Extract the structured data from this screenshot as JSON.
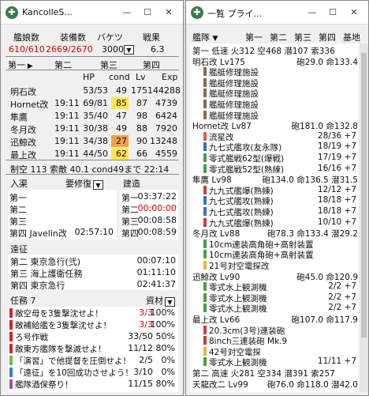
{
  "left": {
    "title": "KancolleS...",
    "stats_head": [
      "艦娘数",
      "装備数",
      "バケツ",
      "戦果"
    ],
    "stats_val": [
      "610/610",
      "2669/2670",
      "3000",
      "6.3"
    ],
    "fleets": [
      "第一",
      "第二",
      "第三",
      "第四"
    ],
    "ship_head": [
      "HP",
      "cond",
      "Lv",
      "Exp"
    ],
    "ships": [
      {
        "name": "明石改",
        "time": "",
        "hp": "53/53",
        "cond": "49",
        "lv": "175",
        "exp": "144288",
        "hl": ""
      },
      {
        "name": "Hornet改",
        "time": "19:11",
        "hp": "69/81",
        "cond": "85",
        "lv": "87",
        "exp": "4739",
        "hl": "#ffe84f"
      },
      {
        "name": "隼鷹",
        "time": "19:11",
        "hp": "35/40",
        "cond": "47",
        "lv": "98",
        "exp": "6424",
        "hl": ""
      },
      {
        "name": "冬月改",
        "time": "19:11",
        "hp": "30/38",
        "cond": "49",
        "lv": "88",
        "exp": "7920",
        "hl": ""
      },
      {
        "name": "迅鯨改",
        "time": "19:11",
        "hp": "34/38",
        "cond": "27",
        "lv": "90",
        "exp": "13248",
        "hl": "#f5a14a"
      },
      {
        "name": "最上改",
        "time": "19:11",
        "hp": "44/50",
        "cond": "62",
        "lv": "66",
        "exp": "4559",
        "hl": "#ffe84f"
      }
    ],
    "summary": "制空 113 索敵 40.1 cond49まで 22:14",
    "nyukyo": {
      "label": "入渠",
      "btn": "要修復",
      "rows": [
        [
          "第一",
          ""
        ],
        [
          "第二",
          ""
        ],
        [
          "第三",
          ""
        ],
        [
          "第四 Javelin改",
          "02:57:10"
        ]
      ]
    },
    "kenzo": {
      "label": "建造",
      "rows": [
        [
          "第一",
          "03:37:22",
          false
        ],
        [
          "第二",
          "00:00:00",
          true
        ],
        [
          "第三",
          "00:08:58",
          false
        ],
        [
          "第四",
          "00:08:59",
          false
        ]
      ]
    },
    "ensei": {
      "label": "遠征",
      "rows": [
        [
          "第二 東京急行(弐)",
          "00:07:10"
        ],
        [
          "第三 海上護衛任務",
          "01:11:10"
        ],
        [
          "第四 東京急行",
          "02:41:37"
        ]
      ]
    },
    "quests": {
      "label": "任務 7",
      "btn": "資材",
      "rows": [
        {
          "name": "敵空母を3隻撃沈せよ！",
          "prog": "3/3",
          "pct": "100%",
          "color": "#d22",
          "red": true
        },
        {
          "name": "敵補給艦を3隻撃沈せよ！",
          "prog": "3/3",
          "pct": "100%",
          "color": "#d22",
          "red": true
        },
        {
          "name": "ろ号作戦",
          "prog": "33/50",
          "pct": "50%",
          "color": "#d22",
          "red": false
        },
        {
          "name": "敵東方艦隊を撃滅せよ！",
          "prog": "11/12",
          "pct": "80%",
          "color": "#d22",
          "red": false
        },
        {
          "name": "「演習」で他提督を圧倒せよ！",
          "prog": "2/5",
          "pct": "0%",
          "color": "#6cbf4a",
          "red": false
        },
        {
          "name": "「遠征」を10回成功させよう！",
          "prog": "3/10",
          "pct": "0%",
          "color": "#3b7bd8",
          "red": false
        },
        {
          "name": "艦隊酒保祭り！",
          "prog": "11/15",
          "pct": "80%",
          "color": "#a050c0",
          "red": false
        }
      ]
    }
  },
  "right": {
    "title": "一覧 プライ...",
    "tabs": [
      "艦隊",
      "第一",
      "第二",
      "第三",
      "第四",
      "基地"
    ],
    "lines": [
      {
        "t": "h",
        "text": "第一 低速  火312 空468 潜107 索336"
      },
      {
        "t": "s",
        "name": "明石改 Lv175",
        "stat": "砲29.0 命133.4"
      },
      {
        "t": "e",
        "c": "#8b6c4f",
        "name": "艦艇修理施設",
        "v": ""
      },
      {
        "t": "e",
        "c": "#8b6c4f",
        "name": "艦艇修理施設",
        "v": ""
      },
      {
        "t": "e",
        "c": "#8b6c4f",
        "name": "艦艇修理施設",
        "v": ""
      },
      {
        "t": "e",
        "c": "#8b6c4f",
        "name": "艦艇修理施設",
        "v": ""
      },
      {
        "t": "e",
        "c": "#8b6c4f",
        "name": "艦艇修理施設",
        "v": ""
      },
      {
        "t": "s",
        "name": "Hornet改 Lv87",
        "stat": "砲181.0 命132.8"
      },
      {
        "t": "e",
        "c": "#e25b35",
        "name": "流星改",
        "v": "28/36 +7"
      },
      {
        "t": "e",
        "c": "#3b6fc8",
        "name": "九七式艦攻(友永隊)",
        "v": "18/19 +7"
      },
      {
        "t": "e",
        "c": "#43a048",
        "name": "零式艦戦62型(爆戦)",
        "v": "17/19 +7"
      },
      {
        "t": "e",
        "c": "#43a048",
        "name": "零式艦戦52型(熟練)",
        "v": "16/16 +7"
      },
      {
        "t": "s",
        "name": "隼鷹 Lv98",
        "stat": "砲134.0 命136.5 潜31.5"
      },
      {
        "t": "e",
        "c": "#d23a3a",
        "name": "九九式艦爆(熟練)",
        "v": "12/12 +7"
      },
      {
        "t": "e",
        "c": "#3b6fc8",
        "name": "九七式艦攻(熟練)",
        "v": "18/18 +7"
      },
      {
        "t": "e",
        "c": "#3b6fc8",
        "name": "九七式艦攻(熟練)",
        "v": "18/18 +7"
      },
      {
        "t": "e",
        "c": "#d23a3a",
        "name": "九九式艦爆(熟練)",
        "v": "10/10 +7"
      },
      {
        "t": "s",
        "name": "冬月改 Lv88",
        "stat": "砲78.3 命133.4 潜29.2"
      },
      {
        "t": "e",
        "c": "#43a048",
        "name": "10cm連装高角砲+高射装置",
        "v": ""
      },
      {
        "t": "e",
        "c": "#43a048",
        "name": "10cm連装高角砲+高射装置",
        "v": ""
      },
      {
        "t": "e",
        "c": "#e8b23a",
        "name": "21号対空電探改",
        "v": ""
      },
      {
        "t": "s",
        "name": "迅鯨改 Lv90",
        "stat": "砲45.0 命120.9"
      },
      {
        "t": "e",
        "c": "#43a048",
        "name": "零式水上観測機",
        "v": "2/2 +7"
      },
      {
        "t": "e",
        "c": "#43a048",
        "name": "零式水上観測機",
        "v": "2/2 +7"
      },
      {
        "t": "e",
        "c": "#43a048",
        "name": "零式水上観測機",
        "v": "2/2 +7"
      },
      {
        "t": "s",
        "name": "最上改 Lv66",
        "stat": "砲107.0 命117.9"
      },
      {
        "t": "e",
        "c": "#d23a3a",
        "name": "20.3cm(3号)連装砲",
        "v": ""
      },
      {
        "t": "e",
        "c": "#d23a3a",
        "name": "8inch三連装砲 Mk.9",
        "v": ""
      },
      {
        "t": "e",
        "c": "#e8b23a",
        "name": "42号対空電探",
        "v": ""
      },
      {
        "t": "e",
        "c": "#43a048",
        "name": "零式水上観測機",
        "v": "11/11 +7"
      },
      {
        "t": "h",
        "text": "第二 高速  火281 空334 潜391 索257"
      },
      {
        "t": "s",
        "name": "天龍改二 Lv99",
        "stat": "砲76.0 命118.0 潜42.0"
      }
    ]
  }
}
